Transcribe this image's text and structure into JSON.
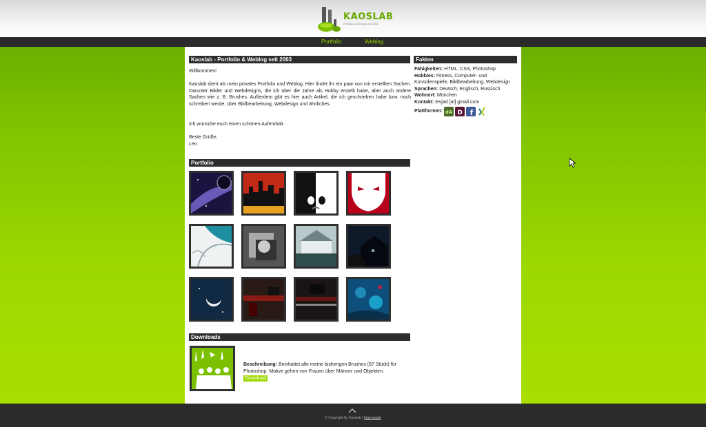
{
  "header": {
    "logo_text": "KAOSLAB",
    "logo_subtitle": "Portfolio & Weblog seit 2003"
  },
  "nav": {
    "items": [
      {
        "label": "Portfolio"
      },
      {
        "label": "Weblog"
      }
    ],
    "color": "#9bd800"
  },
  "intro": {
    "title": "Kaoslab - Portfolio & Weblog seit 2003",
    "greeting": "Willkommen!",
    "body": "Kaoslab dient als mein privates Portfolio und Weblog. Hier findet ihr ein paar von mir erstellten Sachen. Darunter Bilder und Webdesigns, die ich über die Jahre als Hobby erstellt habe, aber auch andere Sachen wie z. B. Brushes. Außerdem gibt es hier auch Artikel, die ich geschrieben habe bzw. noch schreiben werde, über Bildbearbeitung, Webdesign und ähnliches.",
    "wish": "Ich wünsche euch einen schönen Aufenthalt.",
    "closing": "Beste Grüße,",
    "signature": "Leo"
  },
  "facts": {
    "title": "Fakten",
    "items": [
      {
        "key": "Fähigkeiten:",
        "value": "HTML, CSS, Photoshop"
      },
      {
        "key": "Hobbies:",
        "value": "Fitness, Computer- und Konsolenspiele, Bildbearbeitung, Webdesign"
      },
      {
        "key": "Sprachen:",
        "value": "Deutsch, Englisch, Russisch"
      },
      {
        "key": "Wohnort:",
        "value": "München"
      },
      {
        "key": "Kontakt:",
        "value": "levjad [at] gmail.com"
      }
    ],
    "platforms_label": "Plattformen:",
    "platforms": [
      {
        "icon": "deviantart-icon",
        "color": "#4a6b2a"
      },
      {
        "icon": "zerply-icon",
        "color": "#5a1638"
      },
      {
        "icon": "facebook-icon",
        "color": "#3b5998"
      },
      {
        "icon": "xing-icon",
        "color": "#ffffff"
      }
    ]
  },
  "portfolio": {
    "title": "Portfolio",
    "items": [
      {
        "icon": "galaxy-artwork"
      },
      {
        "icon": "city-skyline-artwork"
      },
      {
        "icon": "black-white-face-artwork"
      },
      {
        "icon": "red-mask-artwork"
      },
      {
        "icon": "abstract-swirl-artwork"
      },
      {
        "icon": "grunge-portrait-artwork"
      },
      {
        "icon": "house-artwork"
      },
      {
        "icon": "night-house-artwork"
      },
      {
        "icon": "moon-artwork"
      },
      {
        "icon": "dark-interior-artwork"
      },
      {
        "icon": "dark-room-artwork"
      },
      {
        "icon": "underwater-artwork"
      }
    ]
  },
  "downloads": {
    "title": "Downloads",
    "desc_label": "Beschreibung:",
    "desc_text": "Beinhaltet alle meine bisherigen Brushes (87 Stück) für Photoshop. Motive gehen von Frauen über Männer und Objekten.",
    "download_label": "Download"
  },
  "footer": {
    "copyright": "© Copyright by Kaoslab |",
    "link": "Impressum"
  },
  "colors": {
    "accent": "#9bd800",
    "dark": "#2b2b2b"
  }
}
